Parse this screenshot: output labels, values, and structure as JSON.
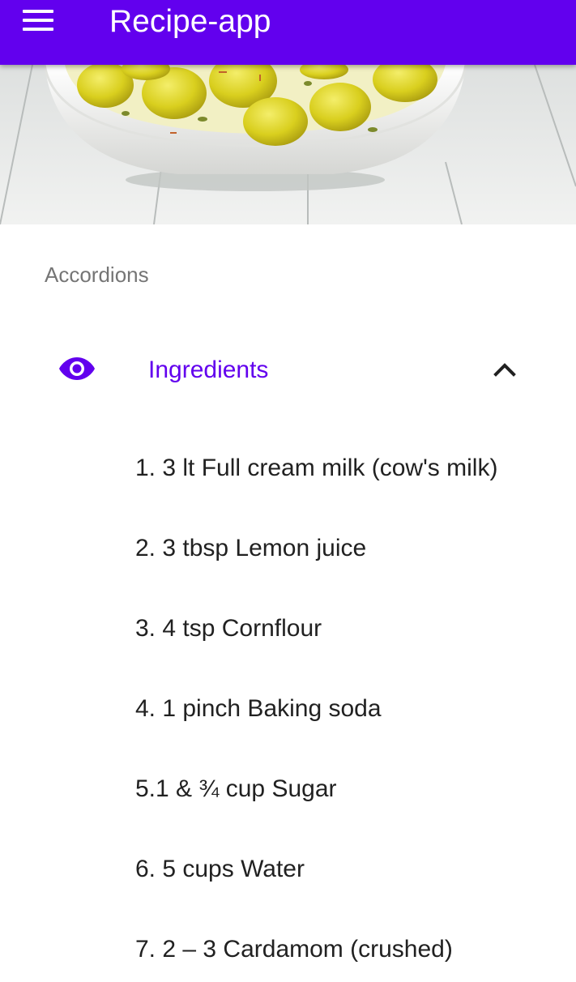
{
  "appbar": {
    "title": "Recipe-app",
    "menu_icon": "menu-icon",
    "color": "#6200ee"
  },
  "hero": {
    "image": "bowl-of-dessert-image"
  },
  "section": {
    "label": "Accordions"
  },
  "accordion": {
    "title": "Ingredients",
    "icon": "eye-icon",
    "toggle_icon": "chevron-up-icon",
    "expanded": true,
    "accent_color": "#6200ee",
    "items": [
      {
        "label": "1. 3 lt Full cream milk (cow's milk)"
      },
      {
        "label": "2. 3 tbsp Lemon juice"
      },
      {
        "label": "3. 4 tsp Cornflour"
      },
      {
        "label": "4. 1 pinch Baking soda"
      },
      {
        "label": "5.1 & ¾ cup Sugar"
      },
      {
        "label": "6. 5 cups Water"
      },
      {
        "label": "7. 2 – 3 Cardamom (crushed)"
      }
    ]
  }
}
